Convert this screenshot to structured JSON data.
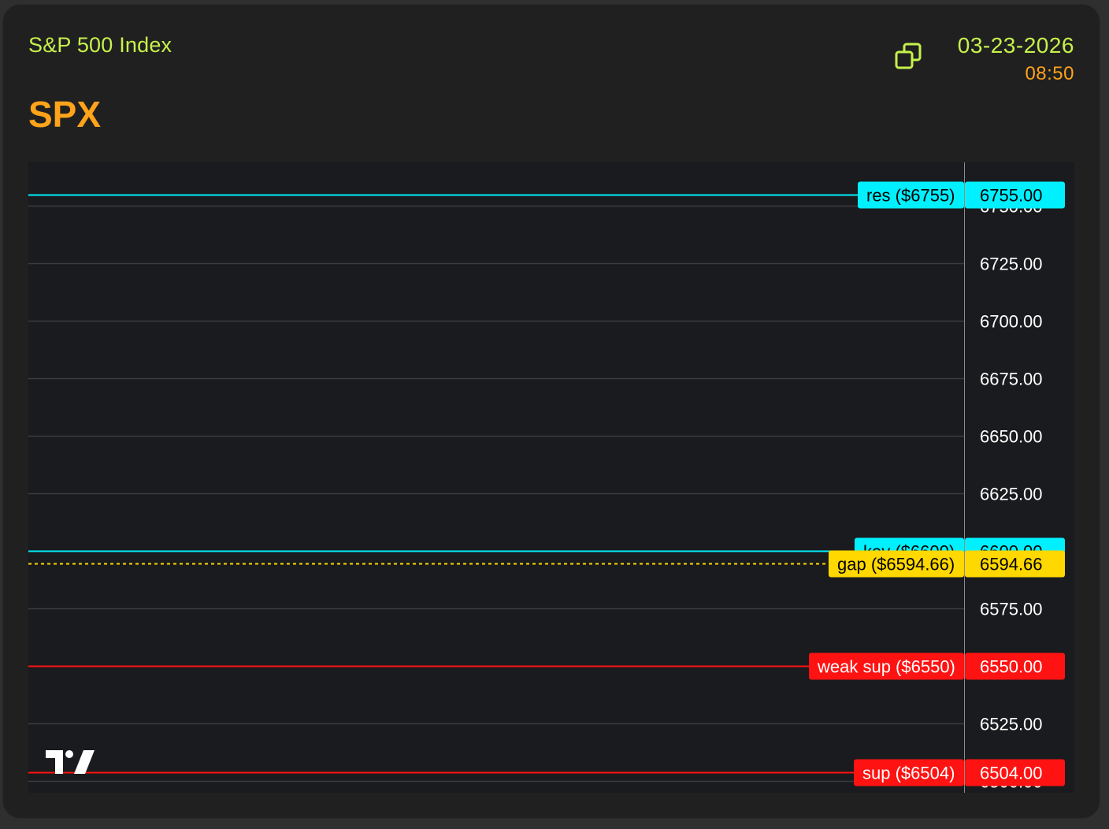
{
  "header": {
    "index_name": "S&P 500 Index",
    "ticker": "SPX",
    "date": "03-23-2026",
    "time": "08:50",
    "copy_icon": "copy-icon"
  },
  "colors": {
    "background": "#1a1b1e",
    "grid": "#3b3c40",
    "axis_text": "#ffffff",
    "accent_green": "#c6f24a",
    "accent_orange": "#ffa31a",
    "resistance": "#00f0ff",
    "gap": "#ffd800",
    "support": "#ff1212"
  },
  "chart_data": {
    "type": "line",
    "title": "",
    "xlabel": "",
    "ylabel": "",
    "ylim": [
      6495,
      6769
    ],
    "y_ticks": [
      6500,
      6525,
      6550,
      6575,
      6600,
      6625,
      6650,
      6675,
      6700,
      6725,
      6750
    ],
    "y_tick_labels": [
      "6500.00",
      "6525.00",
      "6550.00",
      "6575.00",
      "6600.00",
      "6625.00",
      "6650.00",
      "6675.00",
      "6700.00",
      "6725.00",
      "6750.00"
    ],
    "grid": true,
    "levels": [
      {
        "name": "res",
        "label": "res ($6755)",
        "value": 6755,
        "value_label": "6755.00",
        "color": "#00f0ff",
        "text_color": "#000000",
        "style": "solid"
      },
      {
        "name": "key",
        "label": "key ($6600)",
        "value": 6600,
        "value_label": "6600.00",
        "color": "#00f0ff",
        "text_color": "#000000",
        "style": "solid"
      },
      {
        "name": "gap",
        "label": "gap ($6594.66)",
        "value": 6594.66,
        "value_label": "6594.66",
        "color": "#ffd800",
        "text_color": "#000000",
        "style": "dashed"
      },
      {
        "name": "weak sup",
        "label": "weak sup ($6550)",
        "value": 6550,
        "value_label": "6550.00",
        "color": "#ff1212",
        "text_color": "#ffffff",
        "style": "solid"
      },
      {
        "name": "sup",
        "label": "sup ($6504)",
        "value": 6504,
        "value_label": "6504.00",
        "color": "#ff1212",
        "text_color": "#ffffff",
        "style": "solid"
      }
    ],
    "watermark_icon": "tradingview-logo-icon"
  }
}
